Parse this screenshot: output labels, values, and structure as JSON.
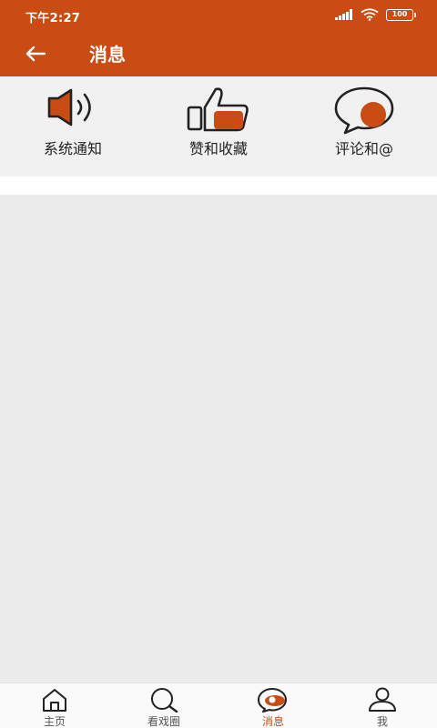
{
  "status_bar": {
    "time": "下午2:27",
    "battery": "100"
  },
  "header": {
    "title": "消息",
    "back_icon": "arrow-left-icon"
  },
  "categories": [
    {
      "label": "系统通知",
      "icon": "speaker-icon"
    },
    {
      "label": "赞和收藏",
      "icon": "thumbs-up-icon"
    },
    {
      "label": "评论和@",
      "icon": "speech-bubble-icon"
    }
  ],
  "bottom_nav": {
    "active_index": 2,
    "items": [
      {
        "label": "主页",
        "icon": "home-icon"
      },
      {
        "label": "看戏圈",
        "icon": "search-icon"
      },
      {
        "label": "消息",
        "icon": "message-eye-icon"
      },
      {
        "label": "我",
        "icon": "person-icon"
      }
    ]
  },
  "colors": {
    "brand": "#c84c14",
    "background": "#efefef",
    "text": "#222222",
    "nav_inactive": "#555555"
  }
}
